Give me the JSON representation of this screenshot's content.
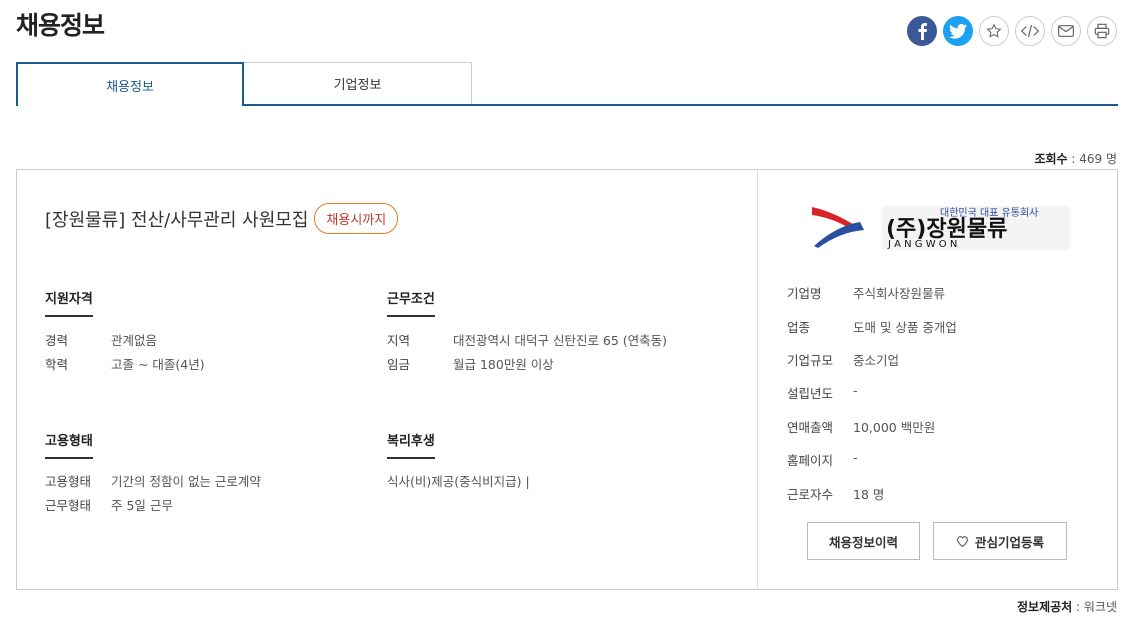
{
  "page": {
    "title": "채용정보"
  },
  "share": [
    {
      "icon": "facebook-icon"
    },
    {
      "icon": "twitter-icon"
    },
    {
      "icon": "star-icon"
    },
    {
      "icon": "code-icon"
    },
    {
      "icon": "mail-icon"
    },
    {
      "icon": "print-icon"
    }
  ],
  "tabs": [
    {
      "label": "채용정보",
      "active": true
    },
    {
      "label": "기업정보",
      "active": false
    }
  ],
  "views": {
    "label": "조회수",
    "value": "469 명"
  },
  "job": {
    "title": "[장원물류] 전산/사무관리 사원모집",
    "deadline": "채용시까지"
  },
  "sections": {
    "qualification": {
      "heading": "지원자격",
      "rows": [
        {
          "k": "경력",
          "v": "관계없음"
        },
        {
          "k": "학력",
          "v": "고졸 ~ 대졸(4년)"
        }
      ]
    },
    "conditions": {
      "heading": "근무조건",
      "rows": [
        {
          "k": "지역",
          "v": "대전광역시 대덕구 신탄진로 65 (연축동)"
        },
        {
          "k": "임금",
          "v": "월급 180만원 이상"
        }
      ]
    },
    "employment": {
      "heading": "고용형태",
      "rows": [
        {
          "k": "고용형태",
          "v": "기간의 정함이 없는 근로계약"
        },
        {
          "k": "근무형태",
          "v": "주 5일 근무"
        }
      ]
    },
    "welfare": {
      "heading": "복리후생",
      "text": "식사(비)제공(중식비지급) |"
    }
  },
  "company": {
    "logo": {
      "tagline": "대한민국 대표 유통회사",
      "name": "(주)장원물류",
      "roman": "J A N G W O N"
    },
    "info": [
      {
        "k": "기업명",
        "v": "주식회사장원물류"
      },
      {
        "k": "업종",
        "v": "도매 및 상품 중개업"
      },
      {
        "k": "기업규모",
        "v": "중소기업"
      },
      {
        "k": "설립년도",
        "v": "-"
      },
      {
        "k": "연매출액",
        "v": "10,000 백만원"
      },
      {
        "k": "홈페이지",
        "v": "-"
      },
      {
        "k": "근로자수",
        "v": "18 명"
      }
    ],
    "buttons": {
      "history": "채용정보이력",
      "favorite": "관심기업등록"
    }
  },
  "source": {
    "label": "정보제공처",
    "value": "워크넷"
  }
}
